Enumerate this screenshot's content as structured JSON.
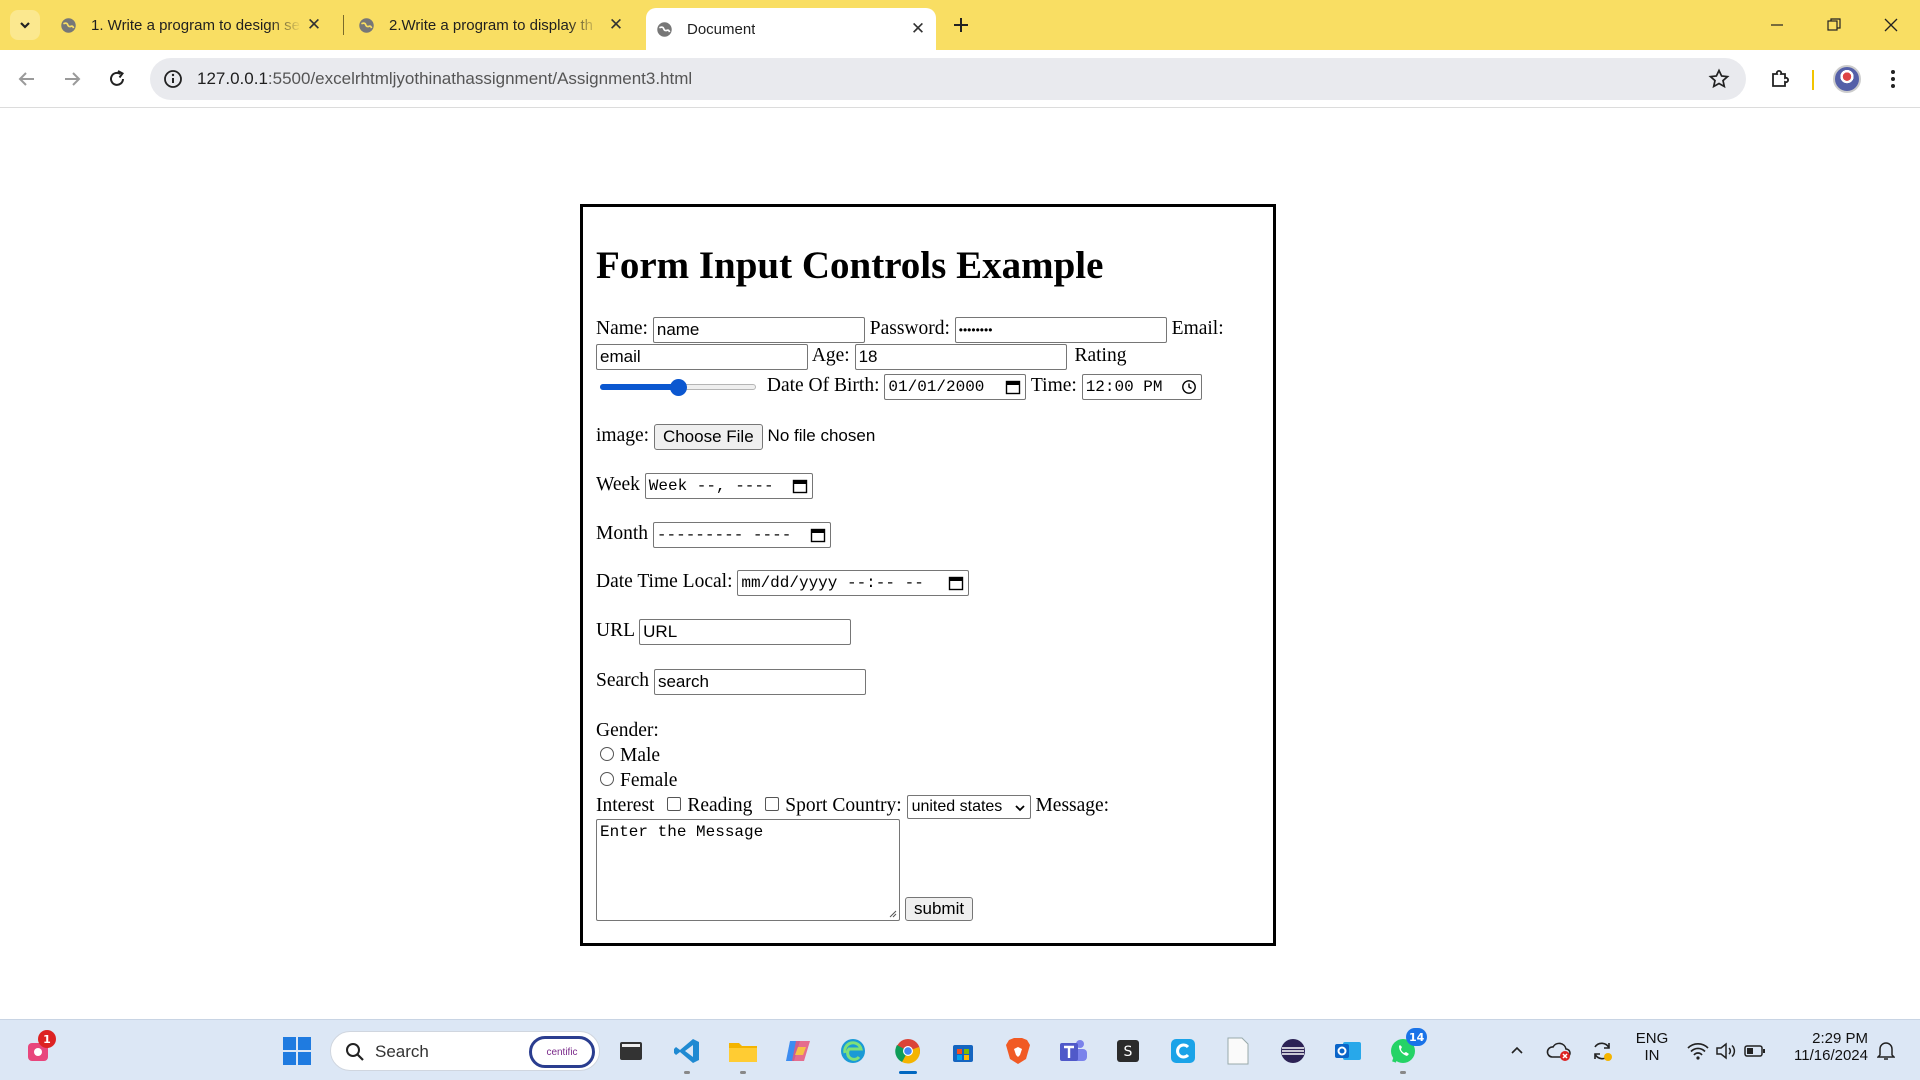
{
  "browser": {
    "tabs": [
      {
        "title": "1. Write a program to design se"
      },
      {
        "title": "2.Write a program to display th"
      },
      {
        "title": "Document"
      }
    ],
    "url_host": "127.0.0.1",
    "url_rest": ":5500/excelrhtmljyothinathassignment/Assignment3.html"
  },
  "form": {
    "heading": "Form Input Controls Example",
    "name_label": "Name:",
    "name_value": "name",
    "password_label": "Password:",
    "password_mask": "••••••••",
    "email_label": "Email:",
    "email_value": "email",
    "age_label": "Age:",
    "age_value": "18",
    "rating_label": "Rating",
    "rating_level": 0.5,
    "dob_label": "Date Of Birth:",
    "dob_value": "01/01/2000",
    "time_label": "Time:",
    "time_value": "12:00 PM",
    "image_label": "image:",
    "file_button": "Choose File",
    "file_status": "No file chosen",
    "week_label": "Week",
    "week_value": "Week --, ----",
    "month_label": "Month",
    "month_value": "--------- ----",
    "datetime_label": "Date Time Local:",
    "datetime_value": "mm/dd/yyyy --:-- --",
    "url_label": "URL",
    "url_value": "URL",
    "search_label": "Search",
    "search_value": "search",
    "gender_label": "Gender:",
    "gender_options": [
      "Male",
      "Female"
    ],
    "interest_label": "Interest",
    "interest_options": [
      "Reading",
      "Sport"
    ],
    "country_label": "Country:",
    "country_value": "united states",
    "message_label": "Message:",
    "message_value": "Enter the Message",
    "submit_label": "submit"
  },
  "taskbar": {
    "search_placeholder": "Search",
    "search_brand": "centific",
    "badge_left": "1",
    "badge_whatsapp": "14",
    "lang": "ENG",
    "region": "IN",
    "time": "2:29 PM",
    "date": "11/16/2024"
  },
  "colors": {
    "tabbar": "#f9de63",
    "accent": "#0b57d0",
    "taskbar": "#dce7f5"
  }
}
